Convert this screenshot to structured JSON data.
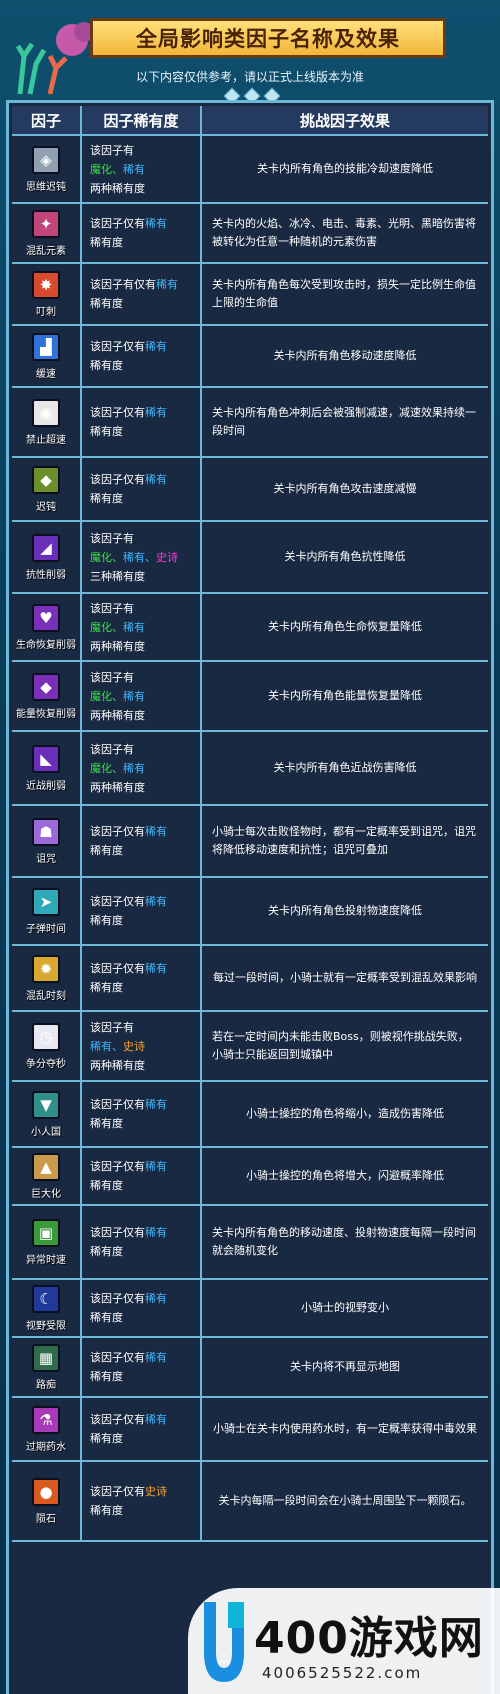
{
  "title": "全局影响类因子名称及效果",
  "subtitle": "以下内容仅供参考，请以正式上线版本为准",
  "headers": [
    "因子",
    "因子稀有度",
    "挑战因子效果"
  ],
  "rows": [
    {
      "name": "思维迟钝",
      "icon": "brain-icon",
      "color": "#8fa0b0",
      "rarity": [
        [
          "该因子有",
          ""
        ],
        [
          "魔化、",
          "g"
        ],
        [
          "稀有",
          "b"
        ],
        [
          "两种稀有度",
          ""
        ]
      ],
      "effect": "关卡内所有角色的技能冷却速度降低",
      "h": 68
    },
    {
      "name": "混乱元素",
      "icon": "elements-icon",
      "color": "#c2457a",
      "rarity": [
        [
          "该因子仅有",
          ""
        ],
        [
          "稀有",
          "b"
        ],
        [
          "稀有度",
          ""
        ]
      ],
      "effect": "关卡内的火焰、冰冷、电击、毒素、光明、黑暗伤害将被转化为任意一种随机的元素伤害",
      "h": 60
    },
    {
      "name": "叮刺",
      "icon": "sting-icon",
      "color": "#d84a2e",
      "rarity": [
        [
          "该因子有仅有",
          ""
        ],
        [
          "稀有",
          "b"
        ],
        [
          "稀有度",
          ""
        ]
      ],
      "effect": "关卡内所有角色每次受到攻击时，损失一定比例生命值上限的生命值",
      "h": 62
    },
    {
      "name": "缓速",
      "icon": "boot-icon",
      "color": "#2f72d8",
      "rarity": [
        [
          "该因子仅有",
          ""
        ],
        [
          "稀有",
          "b"
        ],
        [
          "稀有度",
          ""
        ]
      ],
      "effect": "关卡内所有角色移动速度降低",
      "h": 62
    },
    {
      "name": "禁止超速",
      "icon": "speed-limit-icon",
      "color": "#e8e8e8",
      "rarity": [
        [
          "该因子仅有",
          ""
        ],
        [
          "稀有",
          "b"
        ],
        [
          "稀有度",
          ""
        ]
      ],
      "effect": "关卡内所有角色冲刺后会被强制减速，减速效果持续一段时间",
      "h": 70
    },
    {
      "name": "迟钝",
      "icon": "turtle-icon",
      "color": "#6b8f2a",
      "rarity": [
        [
          "该因子仅有",
          ""
        ],
        [
          "稀有",
          "b"
        ],
        [
          "稀有度",
          ""
        ]
      ],
      "effect": "关卡内所有角色攻击速度减慢",
      "h": 64
    },
    {
      "name": "抗性削弱",
      "icon": "shield-break-icon",
      "color": "#6a2fb8",
      "rarity": [
        [
          "该因子有",
          ""
        ],
        [
          "魔化、",
          "g"
        ],
        [
          "稀有、",
          "b"
        ],
        [
          "史诗",
          "p"
        ],
        [
          "三种稀有度",
          ""
        ]
      ],
      "effect": "关卡内所有角色抗性降低",
      "h": 72
    },
    {
      "name": "生命恢复削弱",
      "icon": "heart-break-icon",
      "color": "#7a2fb8",
      "rarity": [
        [
          "该因子有",
          ""
        ],
        [
          "魔化、",
          "g"
        ],
        [
          "稀有",
          "b"
        ],
        [
          "两种稀有度",
          ""
        ]
      ],
      "effect": "关卡内所有角色生命恢复量降低",
      "h": 68
    },
    {
      "name": "能量恢复削弱",
      "icon": "energy-break-icon",
      "color": "#7a2fb8",
      "rarity": [
        [
          "该因子有",
          ""
        ],
        [
          "魔化、",
          "g"
        ],
        [
          "稀有",
          "b"
        ],
        [
          "两种稀有度",
          ""
        ]
      ],
      "effect": "关卡内所有角色能量恢复量降低",
      "h": 70
    },
    {
      "name": "近战削弱",
      "icon": "sword-break-icon",
      "color": "#6a2fb8",
      "rarity": [
        [
          "该因子有",
          ""
        ],
        [
          "魔化、",
          "g"
        ],
        [
          "稀有",
          "b"
        ],
        [
          "两种稀有度",
          ""
        ]
      ],
      "effect": "关卡内所有角色近战伤害降低",
      "h": 74
    },
    {
      "name": "诅咒",
      "icon": "ghost-icon",
      "color": "#9a6ad8",
      "rarity": [
        [
          "该因子仅有",
          ""
        ],
        [
          "稀有",
          "b"
        ],
        [
          "稀有度",
          ""
        ]
      ],
      "effect": "小骑士每次击败怪物时，都有一定概率受到诅咒，诅咒将降低移动速度和抗性；诅咒可叠加",
      "h": 72
    },
    {
      "name": "子弹时间",
      "icon": "bullet-icon",
      "color": "#2fa8b8",
      "rarity": [
        [
          "该因子仅有",
          ""
        ],
        [
          "稀有",
          "b"
        ],
        [
          "稀有度",
          ""
        ]
      ],
      "effect": "关卡内所有角色投射物速度降低",
      "h": 68
    },
    {
      "name": "混乱时刻",
      "icon": "chaos-icon",
      "color": "#d8a82f",
      "rarity": [
        [
          "该因子仅有",
          ""
        ],
        [
          "稀有",
          "b"
        ],
        [
          "稀有度",
          ""
        ]
      ],
      "effect": "每过一段时间，小骑士就有一定概率受到混乱效果影响",
      "h": 66
    },
    {
      "name": "争分夺秒",
      "icon": "clock-icon",
      "color": "#e8e8f0",
      "rarity": [
        [
          "该因子有",
          ""
        ],
        [
          "稀有、",
          "b"
        ],
        [
          "史诗",
          "y"
        ],
        [
          "两种稀有度",
          ""
        ]
      ],
      "effect": "若在一定时间内未能击败Boss，则被视作挑战失败，小骑士只能返回到城镇中",
      "h": 70
    },
    {
      "name": "小人国",
      "icon": "shrink-icon",
      "color": "#2f8f8a",
      "rarity": [
        [
          "该因子仅有",
          ""
        ],
        [
          "稀有",
          "b"
        ],
        [
          "稀有度",
          ""
        ]
      ],
      "effect": "小骑士操控的角色将缩小，造成伤害降低",
      "h": 66
    },
    {
      "name": "巨大化",
      "icon": "grow-icon",
      "color": "#c89a4a",
      "rarity": [
        [
          "该因子仅有",
          ""
        ],
        [
          "稀有",
          "b"
        ],
        [
          "稀有度",
          ""
        ]
      ],
      "effect": "小骑士操控的角色将增大，闪避概率降低",
      "h": 58
    },
    {
      "name": "异常时速",
      "icon": "monitor-icon",
      "color": "#3a9a3a",
      "rarity": [
        [
          "该因子仅有",
          ""
        ],
        [
          "稀有",
          "b"
        ],
        [
          "稀有度",
          ""
        ]
      ],
      "effect": "关卡内所有角色的移动速度、投射物速度每隔一段时间就会随机变化",
      "h": 74
    },
    {
      "name": "视野受限",
      "icon": "night-icon",
      "color": "#1f3a9a",
      "rarity": [
        [
          "该因子仅有",
          ""
        ],
        [
          "稀有",
          "b"
        ],
        [
          "稀有度",
          ""
        ]
      ],
      "effect": "小骑士的视野变小",
      "h": 58
    },
    {
      "name": "路痴",
      "icon": "maze-icon",
      "color": "#2f6a4a",
      "rarity": [
        [
          "该因子仅有",
          ""
        ],
        [
          "稀有",
          "b"
        ],
        [
          "稀有度",
          ""
        ]
      ],
      "effect": "关卡内将不再显示地图",
      "h": 60
    },
    {
      "name": "过期药水",
      "icon": "potion-icon",
      "color": "#a83ab8",
      "rarity": [
        [
          "该因子仅有",
          ""
        ],
        [
          "稀有",
          "b"
        ],
        [
          "稀有度",
          ""
        ]
      ],
      "effect": "小骑士在关卡内使用药水时，有一定概率获得中毒效果",
      "h": 64
    },
    {
      "name": "陨石",
      "icon": "meteor-icon",
      "color": "#d85a1f",
      "rarity": [
        [
          "该因子仅有",
          ""
        ],
        [
          "史诗",
          "y"
        ],
        [
          "稀有度",
          ""
        ]
      ],
      "effect": "关卡内每隔一段时间会在小骑士周围坠下一颗陨石。",
      "h": 80
    }
  ],
  "watermark": {
    "brand": "400游戏网",
    "phone": "4006525522.com"
  }
}
